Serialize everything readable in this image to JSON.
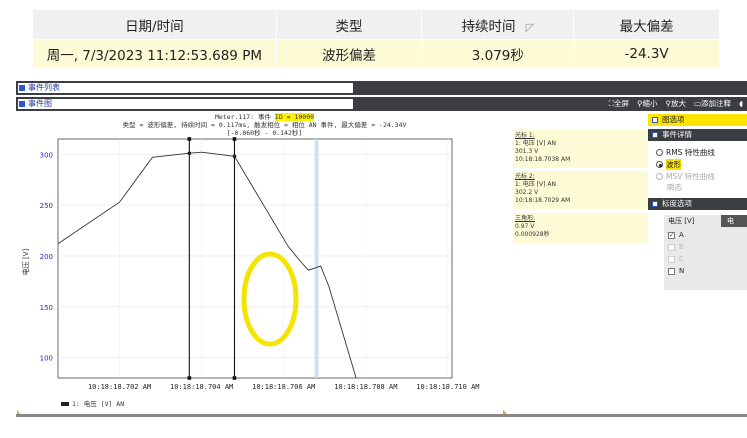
{
  "summary": {
    "headers": [
      "日期/时间",
      "类型",
      "持续时间",
      "最大偏差"
    ],
    "row": [
      "周一, 7/3/2023 11:12:53.689 PM",
      "波形偏差",
      "3.079秒",
      "-24.3V"
    ]
  },
  "panels": {
    "event_list_label": "事件列表",
    "event_graph_label": "事件图"
  },
  "toolbar": {
    "fullscreen": "全屏",
    "zoom_out": "缩小",
    "zoom_in": "放大",
    "add_note": "添加注释"
  },
  "chart_header": {
    "line1_prefix": "Meter.117: 事件",
    "line1_id": "ID = 10000",
    "line2": "类型 = 波形偏差, 持续时间 = 0.117ms, 触发相位 = 相位 AN 事件, 最大偏差 = -24.34V",
    "line3": "[-0.060秒 - 0.142秒]"
  },
  "chart_data": {
    "type": "line",
    "ylabel": "电压 [V]",
    "ylim": [
      80,
      315
    ],
    "yticks": [
      "300",
      "250",
      "200",
      "150",
      "100"
    ],
    "xticks": [
      "10:18:18.702 AM",
      "10:18:18.704 AM",
      "10:18:18.706 AM",
      "10:18:18.708 AM",
      "10:18:18.710 AM"
    ],
    "series": [
      {
        "name": "1: 电压 [V] AN",
        "x": [
          0.0,
          1.5,
          2.3,
          3.2,
          3.5,
          4.3,
          5.6,
          5.9,
          6.1,
          6.4,
          6.6,
          7.3
        ],
        "y": [
          212,
          253,
          297,
          301,
          302,
          298,
          210,
          195,
          186,
          190,
          170,
          75
        ]
      }
    ],
    "cursors_x": [
      3.2,
      4.3
    ],
    "trigger_x": 6.3,
    "legend": "1: 电压 [V] AN"
  },
  "info": {
    "cursor1_title": "光标 1:",
    "cursor1_series": "1: 电压 [V] AN",
    "cursor1_value": "301.3 V",
    "cursor1_time": "10:18:18.7038 AM",
    "cursor2_title": "光标 2:",
    "cursor2_series": "1: 电压 [V] AN",
    "cursor2_value": "302.2 V",
    "cursor2_time": "10:18:18.7029 AM",
    "delta_title": "三角形:",
    "delta_value": "0.97 V",
    "delta_time": "0.000928秒"
  },
  "right_panel": {
    "graph_options": "图选项",
    "event_details": "事件详情",
    "rms_curve": "RMS 特性曲线",
    "waveform": "波形",
    "msv_curve": "MSV 特性曲线",
    "transient": "瞬态",
    "bound_options": "标度选项",
    "voltage_col": "电压 [V]",
    "col2": "电",
    "channels": [
      "A",
      "B",
      "C",
      "N"
    ]
  },
  "colors": {
    "accent_yellow": "#fde400",
    "annotation_yellow": "#f5e400",
    "dark_bar": "#3a3d42",
    "axis_blue": "#2a2ad0"
  }
}
